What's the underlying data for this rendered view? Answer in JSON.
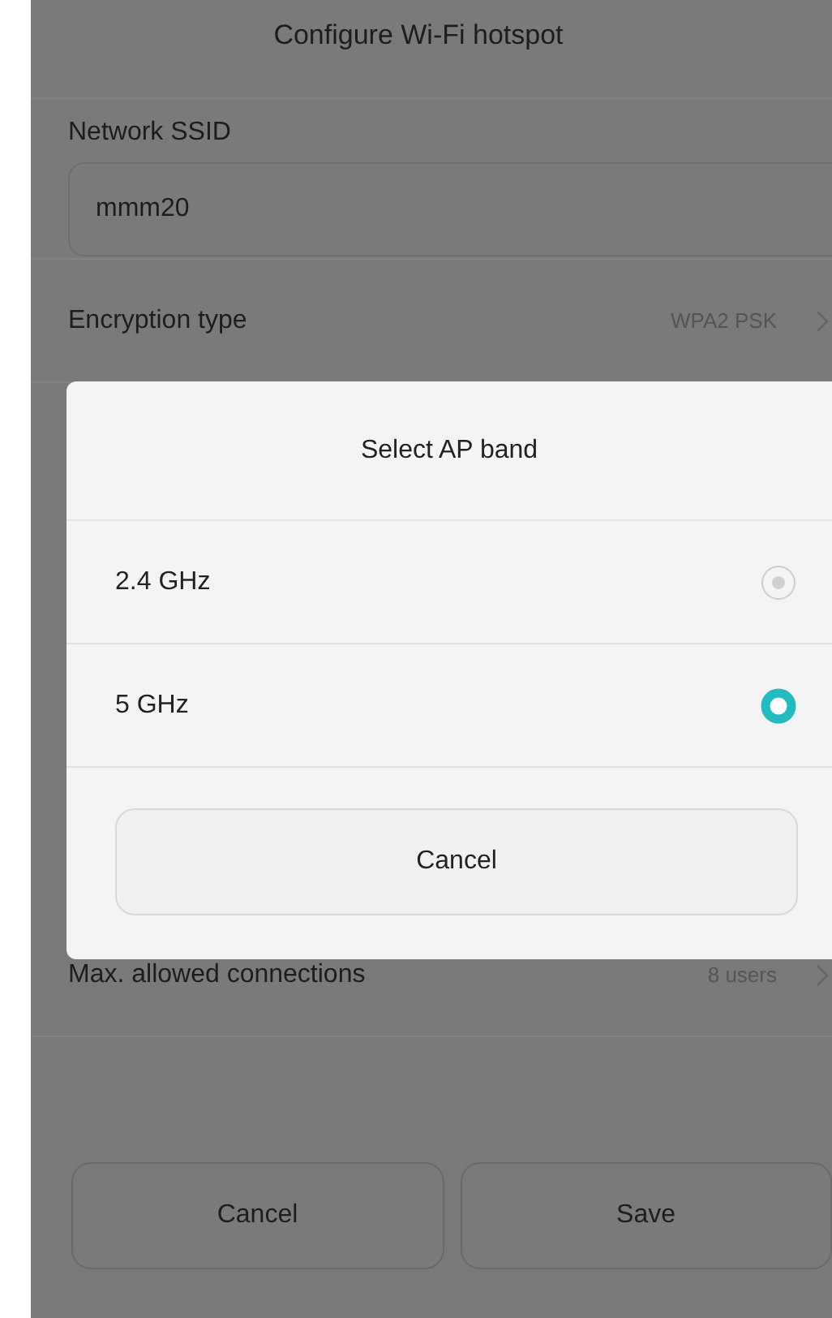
{
  "title": "Configure Wi-Fi hotspot",
  "ssid": {
    "label": "Network SSID",
    "value": "mmm20"
  },
  "settings_top": [
    {
      "label": "Encryption type",
      "value": "WPA2 PSK"
    }
  ],
  "settings_bottom": [
    {
      "label": "Max. allowed connections",
      "value": "8 users"
    }
  ],
  "buttons": [
    "Cancel",
    "Save"
  ],
  "dialog": {
    "title": "Select AP band",
    "options": [
      {
        "label": "2.4 GHz",
        "selected": false
      },
      {
        "label": "5 GHz",
        "selected": true
      }
    ],
    "cancel": "Cancel"
  }
}
